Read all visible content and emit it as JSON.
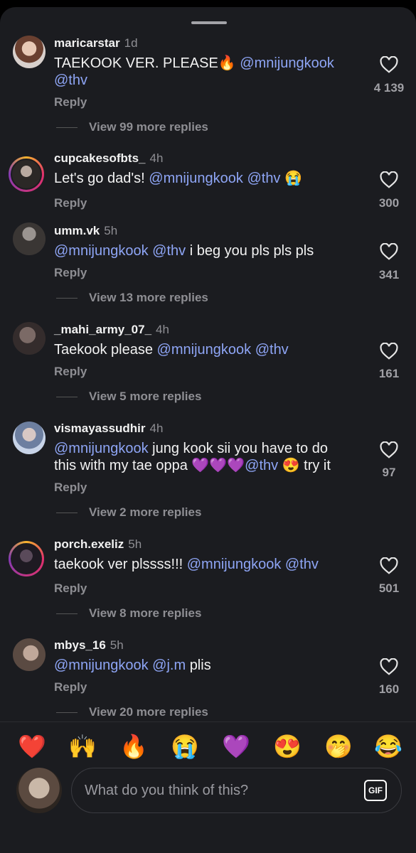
{
  "comments": [
    {
      "user": "maricarstar",
      "time": "1d",
      "text": "TAEKOOK VER. PLEASE🔥",
      "mentions": [
        "@mnijungkook",
        "@thv"
      ],
      "reply": "Reply",
      "likes": "4 139",
      "more": "View 99 more replies"
    },
    {
      "user": "cupcakesofbts_",
      "time": "4h",
      "text_pre": "Let's go dad's!",
      "mentions": [
        "@mnijungkook",
        "@thv"
      ],
      "text_post": "😭",
      "reply": "Reply",
      "likes": "300"
    },
    {
      "user": "umm.vk",
      "time": "5h",
      "mentions": [
        "@mnijungkook",
        "@thv"
      ],
      "text_post": "i beg you pls pls pls",
      "reply": "Reply",
      "likes": "341",
      "more": "View 13 more replies"
    },
    {
      "user": "_mahi_army_07_",
      "time": "4h",
      "text_pre": "Taekook please",
      "mentions": [
        "@mnijungkook",
        "@thv"
      ],
      "reply": "Reply",
      "likes": "161",
      "more": "View 5 more replies"
    },
    {
      "user": "vismayassudhir",
      "time": "4h",
      "mentions": [
        "@mnijungkook",
        "@thv"
      ],
      "text_mid": "jung kook sii you have to do",
      "text_line2": "this with my tae oppa 💜💜💜",
      "text_post": "😍 try it",
      "reply": "Reply",
      "likes": "97",
      "more": "View 2 more replies"
    },
    {
      "user": "porch.exeliz",
      "time": "5h",
      "text_pre": "taekook ver plssss!!!",
      "mentions": [
        "@mnijungkook",
        "@thv"
      ],
      "reply": "Reply",
      "likes": "501",
      "more": "View 8 more replies"
    },
    {
      "user": "mbys_16",
      "time": "5h",
      "mentions": [
        "@mnijungkook",
        "@j.m"
      ],
      "text_post": "plis",
      "reply": "Reply",
      "likes": "160",
      "more": "View 20 more replies"
    }
  ],
  "emojis": [
    "❤️",
    "🙌",
    "🔥",
    "😭",
    "💜",
    "😍",
    "🤭",
    "😂"
  ],
  "composer": {
    "placeholder": "What do you think of this?",
    "gif": "GIF"
  }
}
